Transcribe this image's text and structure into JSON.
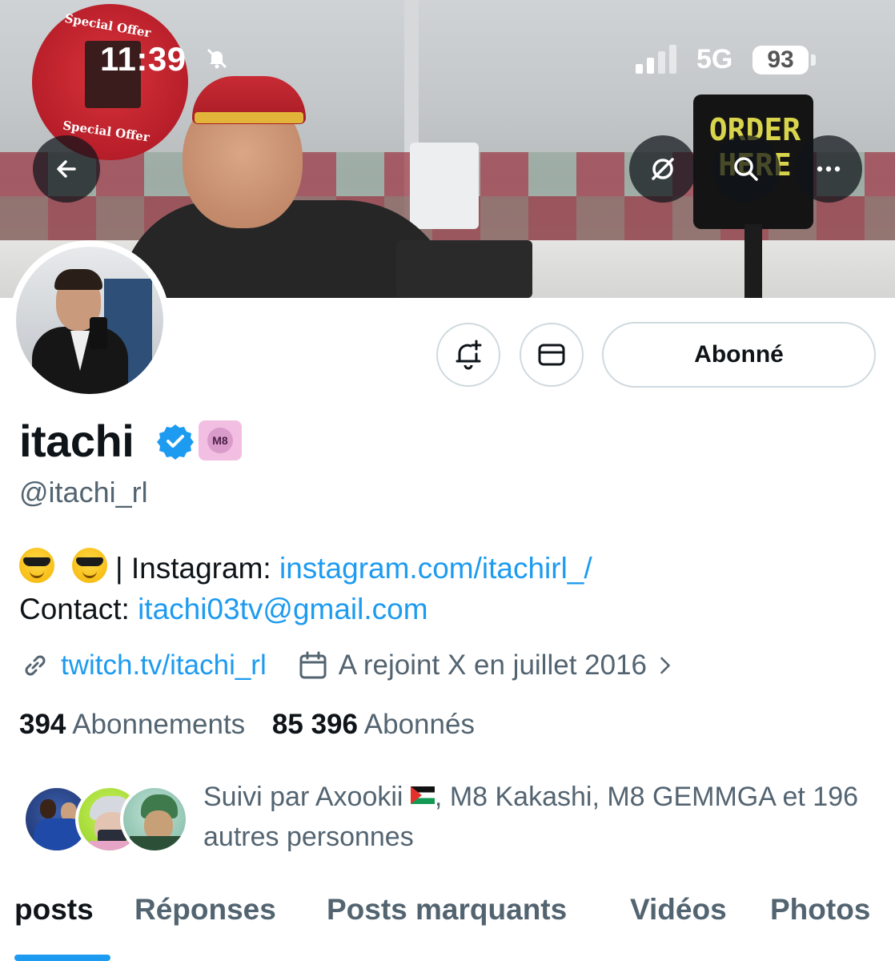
{
  "status_bar": {
    "time": "11:39",
    "network": "5G",
    "battery": "93",
    "icons": [
      "bell-slash-icon",
      "signal-icon"
    ]
  },
  "header": {
    "buttons": [
      "back-arrow-icon",
      "grok-icon",
      "search-icon",
      "more-icon"
    ]
  },
  "banner": {
    "sign_lines": [
      "Special Offer",
      "Special Offer"
    ],
    "order_sign": "ORDER HERE"
  },
  "profile": {
    "display_name": "itachi",
    "handle": "@itachi_rl",
    "affiliate_badge": "M8",
    "verified": true
  },
  "actions": {
    "notify_icon": "bell-plus-icon",
    "message_icon": "envelope-icon",
    "follow_label": "Abonné"
  },
  "bio": {
    "line1_prefix": "| Instagram: ",
    "line1_link": "instagram.com/itachirl_/",
    "line2_prefix": "Contact: ",
    "line2_link": "itachi03tv@gmail.com",
    "emojis": [
      "sunglasses-emoji",
      "sunglasses-emoji"
    ]
  },
  "meta": {
    "website": "twitch.tv/itachi_rl",
    "joined": "A rejoint X en juillet 2016"
  },
  "counts": {
    "following_count": "394",
    "following_label": "Abonnements",
    "followers_count": "85 396",
    "followers_label": "Abonnés"
  },
  "followed_by": {
    "prefix": "Suivi par Axookii",
    "suffix": ", M8 Kakashi, M8 GEMMGA et 196 autres personnes"
  },
  "tabs": [
    {
      "label": "posts",
      "active": true
    },
    {
      "label": "Réponses",
      "active": false
    },
    {
      "label": "Posts marquants",
      "active": false
    },
    {
      "label": "Vidéos",
      "active": false
    },
    {
      "label": "Photos",
      "active": false
    }
  ],
  "colors": {
    "accent": "#1d9bf0",
    "text_primary": "#0f1419",
    "text_secondary": "#536471",
    "border": "#cfd9de"
  }
}
